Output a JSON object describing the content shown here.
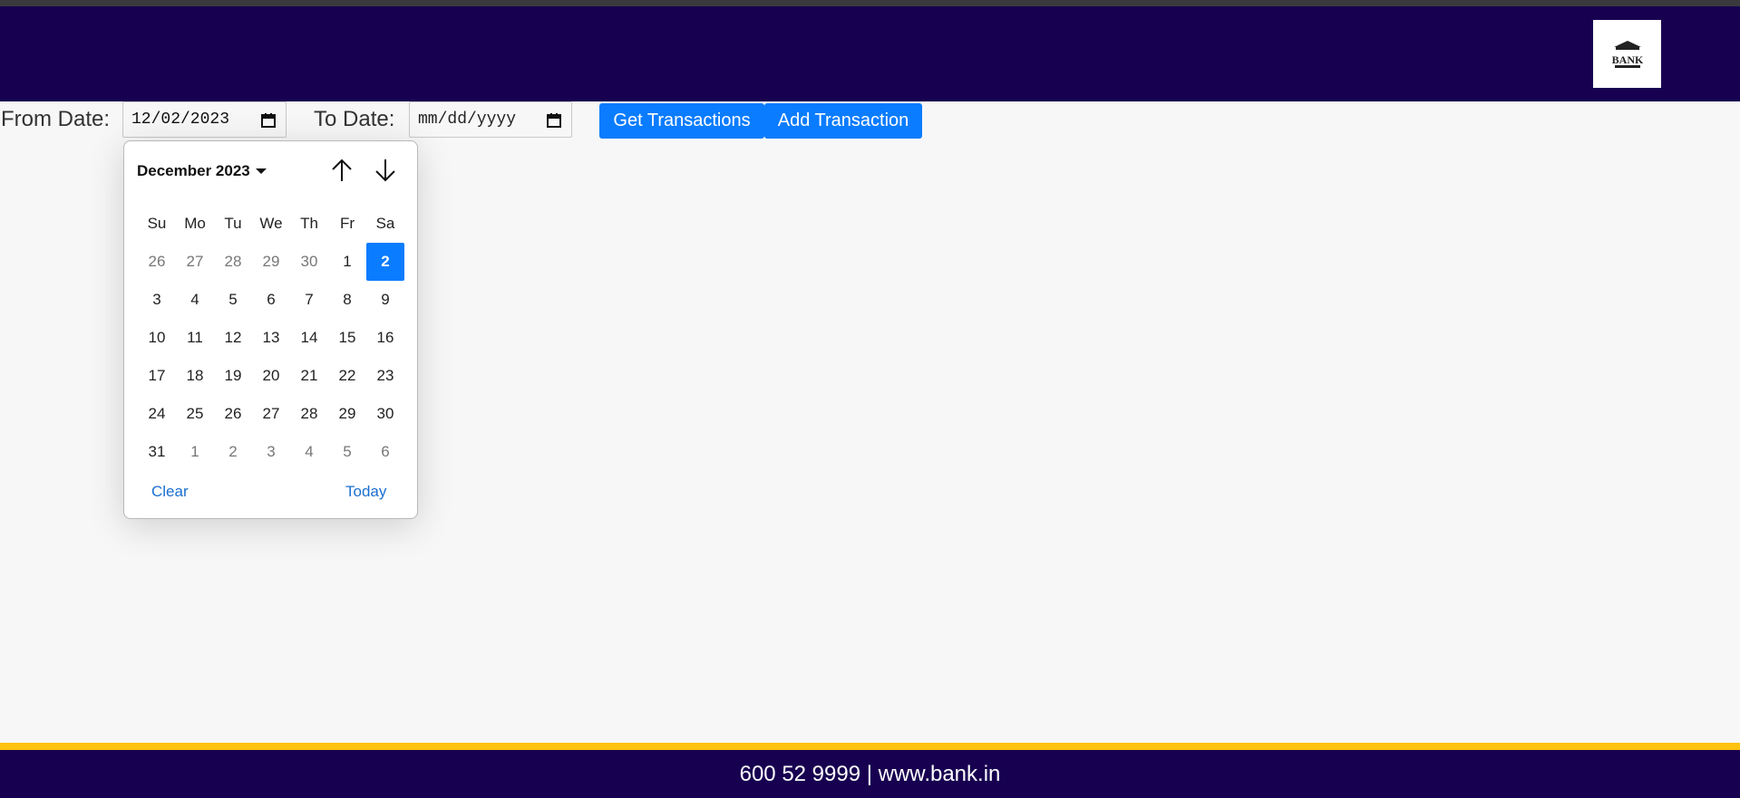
{
  "header": {
    "logo_text": "BANK"
  },
  "filters": {
    "from_label": "From Date:",
    "from_value": "12/02/2023",
    "to_label": "To Date:",
    "to_placeholder": "mm/dd/yyyy"
  },
  "actions": {
    "get_label": "Get Transactions",
    "add_label": "Add Transaction"
  },
  "datepicker": {
    "month_label": "December 2023",
    "weekdays": [
      "Su",
      "Mo",
      "Tu",
      "We",
      "Th",
      "Fr",
      "Sa"
    ],
    "days": [
      {
        "d": "26",
        "out": true
      },
      {
        "d": "27",
        "out": true
      },
      {
        "d": "28",
        "out": true
      },
      {
        "d": "29",
        "out": true
      },
      {
        "d": "30",
        "out": true
      },
      {
        "d": "1"
      },
      {
        "d": "2",
        "selected": true
      },
      {
        "d": "3"
      },
      {
        "d": "4"
      },
      {
        "d": "5"
      },
      {
        "d": "6"
      },
      {
        "d": "7"
      },
      {
        "d": "8"
      },
      {
        "d": "9"
      },
      {
        "d": "10"
      },
      {
        "d": "11"
      },
      {
        "d": "12"
      },
      {
        "d": "13"
      },
      {
        "d": "14"
      },
      {
        "d": "15"
      },
      {
        "d": "16"
      },
      {
        "d": "17"
      },
      {
        "d": "18"
      },
      {
        "d": "19"
      },
      {
        "d": "20"
      },
      {
        "d": "21"
      },
      {
        "d": "22"
      },
      {
        "d": "23"
      },
      {
        "d": "24"
      },
      {
        "d": "25"
      },
      {
        "d": "26"
      },
      {
        "d": "27"
      },
      {
        "d": "28"
      },
      {
        "d": "29"
      },
      {
        "d": "30"
      },
      {
        "d": "31"
      },
      {
        "d": "1",
        "out": true
      },
      {
        "d": "2",
        "out": true
      },
      {
        "d": "3",
        "out": true
      },
      {
        "d": "4",
        "out": true
      },
      {
        "d": "5",
        "out": true
      },
      {
        "d": "6",
        "out": true
      }
    ],
    "clear_label": "Clear",
    "today_label": "Today"
  },
  "footer": {
    "text": "600 52 9999 | www.bank.in"
  },
  "colors": {
    "header_bg": "#170050",
    "accent": "#0a7cff",
    "footer_stripe": "#ffc20e"
  }
}
